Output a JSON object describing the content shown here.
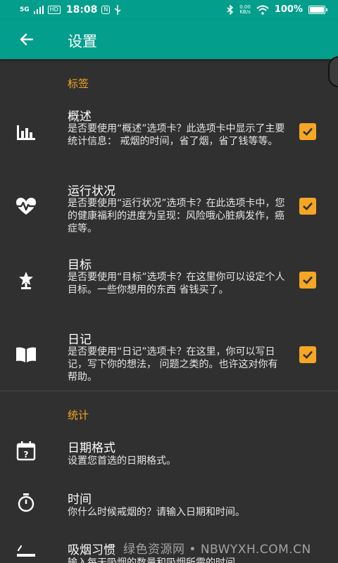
{
  "status_bar": {
    "signal": "5G",
    "hd_badge": "HD",
    "time": "18:08",
    "app_badge": "N",
    "net_speed_value": "0.00",
    "net_speed_unit": "KB/s",
    "battery_text": "100%"
  },
  "app_bar": {
    "title": "设置",
    "back_icon": "arrow-left-icon"
  },
  "sections": {
    "tags": {
      "header": "标签",
      "items": [
        {
          "title": "概述",
          "summary": "是否要使用“概述”选项卡？此选项卡中显示了主要统计信息： 戒烟的时间，省了烟，省了钱等等。",
          "icon": "bar-chart-icon",
          "checked": true
        },
        {
          "title": "运行状况",
          "summary": "是否要使用“运行状况”选项卡？在此选项卡中，您的健康福利的进度为呈现：风险哦心脏病发作，癌症等。",
          "icon": "heart-pulse-icon",
          "checked": true
        },
        {
          "title": "目标",
          "summary": "是否要使用“目标”选项卡？在这里你可以设定个人目标。一些你想用的东西 省钱买了。",
          "icon": "trophy-star-icon",
          "checked": true
        },
        {
          "title": "日记",
          "summary": "是否要使用“日记”选项卡？在这里，你可以写日记，写下你的想法， 问题之类的。也许这对你有帮助。",
          "icon": "open-book-icon",
          "checked": true
        }
      ]
    },
    "stats": {
      "header": "统计",
      "items": [
        {
          "title": "日期格式",
          "summary": "设置您首选的日期格式。",
          "icon": "calendar-question-icon"
        },
        {
          "title": "时间",
          "summary": "你什么时候戒烟的？请输入日期和时间。",
          "icon": "stopwatch-icon"
        },
        {
          "title": "吸烟习惯",
          "summary": "输入每天吸烟的数量和吸烟所需的时间",
          "icon": "cigarette-icon"
        }
      ]
    }
  },
  "colors": {
    "accent": "#F5A623",
    "primary": "#049E8C",
    "background": "#303030"
  },
  "watermark": "绿色资源网 • NBWYXH.COM.CN"
}
